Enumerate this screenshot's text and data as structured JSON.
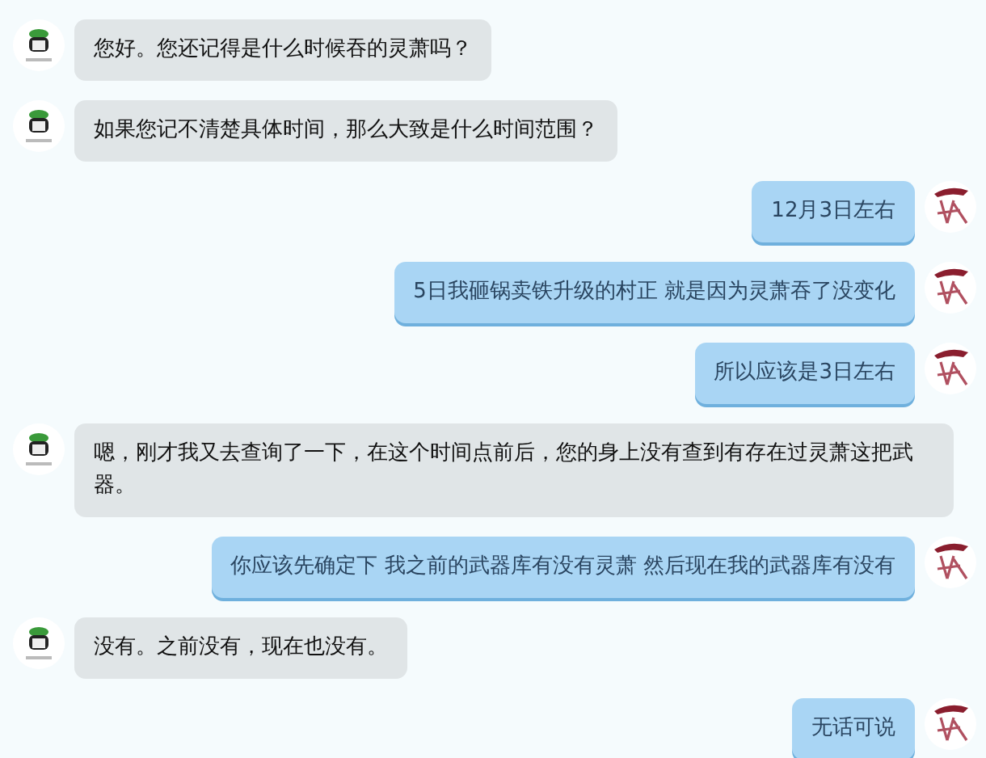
{
  "messages": [
    {
      "kind": "received",
      "text": "您好。您还记得是什么时候吞的灵萧吗？"
    },
    {
      "kind": "received",
      "text": "如果您记不清楚具体时间，那么大致是什么时间范围？"
    },
    {
      "kind": "sent",
      "text": "12月3日左右"
    },
    {
      "kind": "sent",
      "text": "5日我砸锅卖铁升级的村正 就是因为灵萧吞了没变化"
    },
    {
      "kind": "sent",
      "text": "所以应该是3日左右"
    },
    {
      "kind": "received",
      "text": "嗯，刚才我又去查询了一下，在这个时间点前后，您的身上没有查到有存在过灵萧这把武器。"
    },
    {
      "kind": "sent",
      "text": "你应该先确定下 我之前的武器库有没有灵萧  然后现在我的武器库有没有"
    },
    {
      "kind": "received",
      "text": "没有。之前没有，现在也没有。"
    },
    {
      "kind": "sent",
      "text": "无话可说"
    }
  ]
}
